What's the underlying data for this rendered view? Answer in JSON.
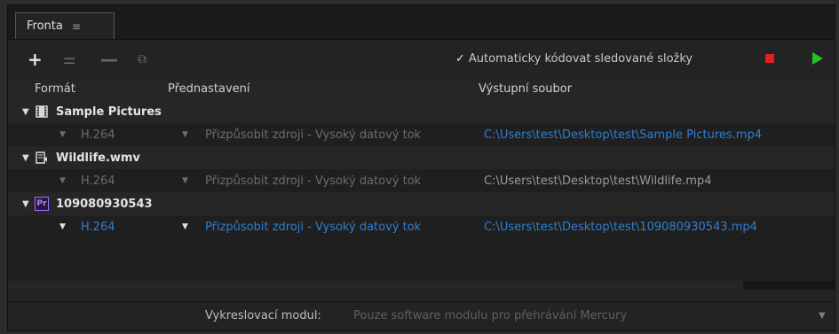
{
  "tab": {
    "label": "Fronta",
    "menu_glyph": "≡"
  },
  "toolbar": {
    "add_glyph": "+",
    "settings_glyph": "⚌",
    "remove_glyph": "—",
    "duplicate_glyph": "⧉",
    "auto_check_mark": "✓",
    "auto_label": "Automaticky kódovat sledované složky"
  },
  "headers": {
    "format": "Formát",
    "preset": "Přednastavení",
    "output": "Výstupní soubor"
  },
  "groups": [
    {
      "name": "Sample Pictures",
      "icon": "film-icon",
      "format": "H.264",
      "preset": "Přizpůsobit zdroji - Vysoký datový tok",
      "output": "C:\\Users\\test\\Desktop\\test\\Sample Pictures.mp4"
    },
    {
      "name": "Wildlife.wmv",
      "icon": "video-clip-icon",
      "format": "H.264",
      "preset": "Přizpůsobit zdroji - Vysoký datový tok",
      "output": "C:\\Users\\test\\Desktop\\test\\Wildlife.mp4"
    },
    {
      "name": "109080930543",
      "icon": "premiere-pro-icon",
      "badge": "Pr",
      "format": "H.264",
      "preset": "Přizpůsobit zdroji - Vysoký datový tok",
      "output": "C:\\Users\\test\\Desktop\\test\\109080930543.mp4"
    }
  ],
  "footer": {
    "renderer_label": "Vykreslovací modul:",
    "renderer_value": "Pouze software modulu pro přehrávání Mercury"
  },
  "colors": {
    "accent_blue": "#2f7fd0",
    "stop_red": "#e02020",
    "play_green": "#22c02a",
    "premiere_purple": "#a070ff"
  }
}
